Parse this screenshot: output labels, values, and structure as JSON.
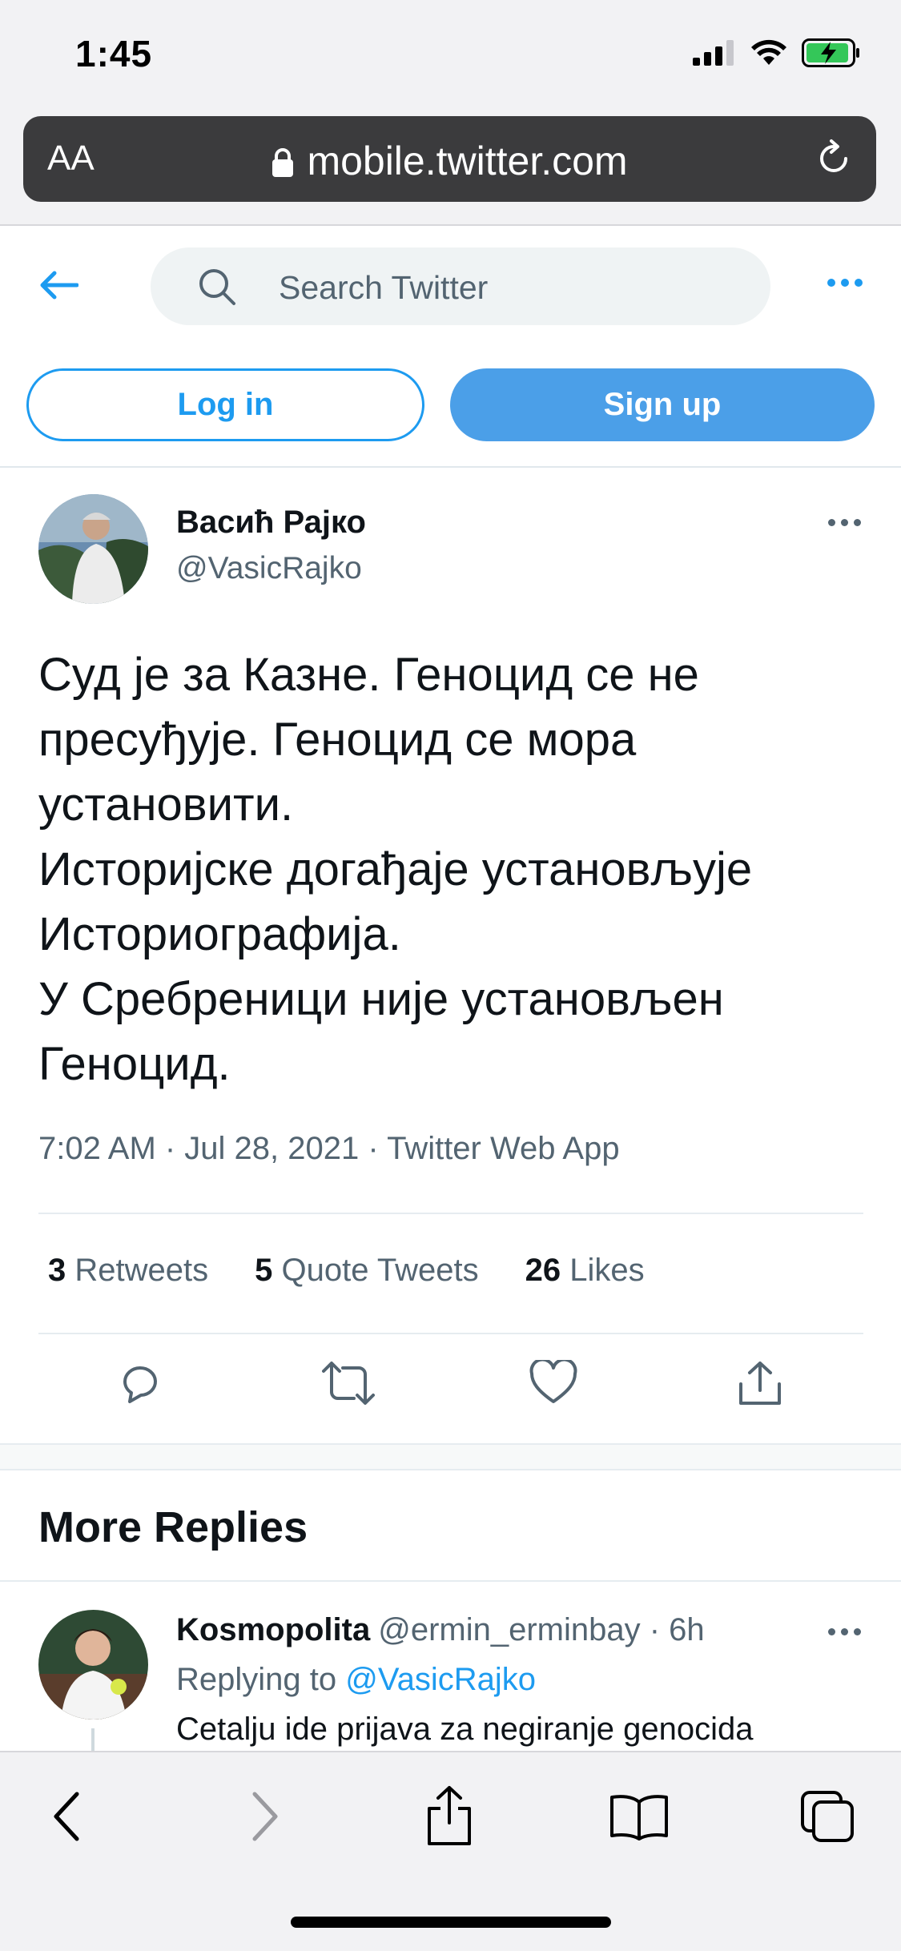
{
  "status_bar": {
    "time": "1:45"
  },
  "safari": {
    "text_size_button": "AA",
    "url": "mobile.twitter.com"
  },
  "twitter_header": {
    "search_placeholder": "Search Twitter",
    "login_label": "Log in",
    "signup_label": "Sign up"
  },
  "tweet": {
    "author_name": "Васић Рајко",
    "author_handle": "@VasicRajko",
    "text_lines": [
      "Суд је за Казне. Геноцид се не",
      "пресуђује. Геноцид се мора",
      "установити.",
      "Историјске догађаје установљује",
      "Историографија.",
      "У Сребреници није установљен",
      "Геноцид."
    ],
    "meta": "7:02 AM · Jul 28, 2021 · Twitter Web App",
    "stats": {
      "retweets_count": "3",
      "retweets_label": "Retweets",
      "quotes_count": "5",
      "quotes_label": "Quote Tweets",
      "likes_count": "26",
      "likes_label": "Likes"
    }
  },
  "more_replies": {
    "heading": "More Replies",
    "reply": {
      "name": "Kosmopolita",
      "handle_time": "@ermin_erminbay · 6h",
      "replying_prefix": "Replying to",
      "replying_to": "@VasicRajko",
      "text": "Cetalju ide prijava za negiranje genocida"
    }
  },
  "icons": {
    "back": "arrow-left-icon",
    "search": "search-icon",
    "more": "more-dots-icon",
    "reply": "reply-bubble-icon",
    "retweet": "retweet-icon",
    "like": "heart-icon",
    "share": "share-icon"
  },
  "colors": {
    "twitter_blue": "#1d9bf0",
    "signup_bg": "#4b9fe8",
    "muted_text": "#536471",
    "address_bar_bg": "#3b3b3d"
  }
}
